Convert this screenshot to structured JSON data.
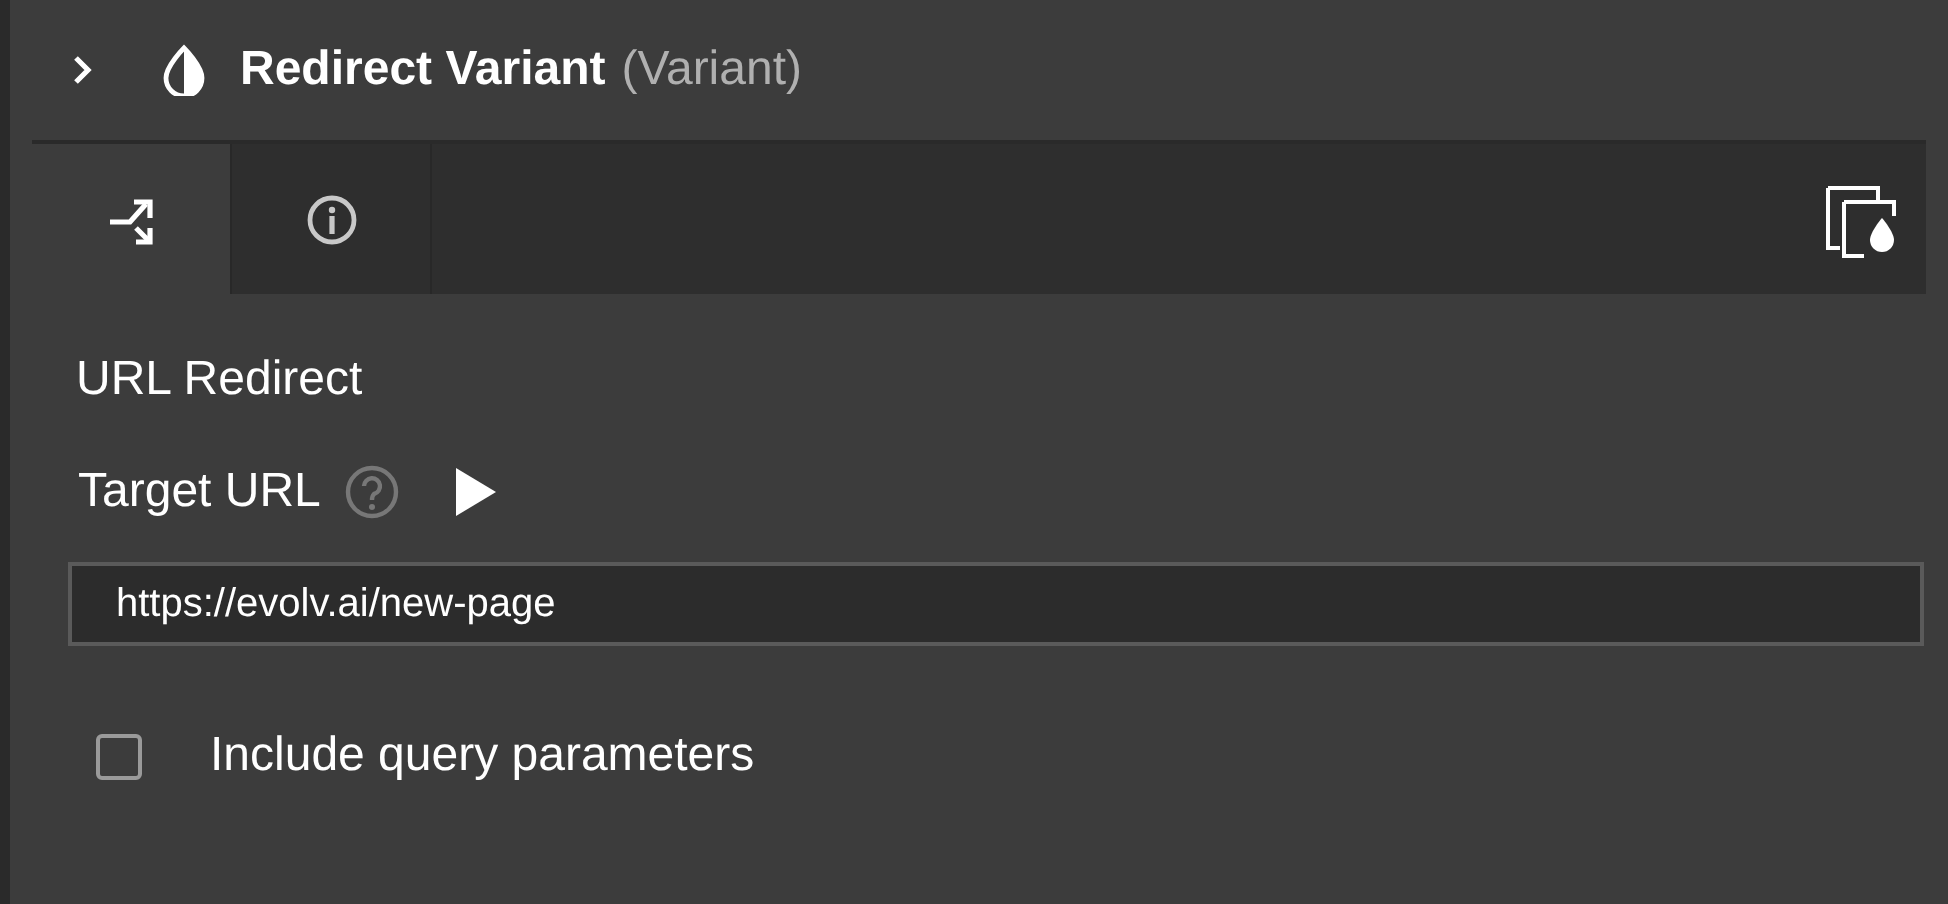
{
  "header": {
    "expanded": false,
    "title": "Redirect Variant",
    "subtitle": "(Variant)"
  },
  "tabs": [
    {
      "kind": "redirect",
      "selected": true
    },
    {
      "kind": "info",
      "selected": false
    }
  ],
  "section_title": "URL Redirect",
  "target_url": {
    "label": "Target URL",
    "value": "https://evolv.ai/new-page"
  },
  "options": [
    {
      "label": "Include query parameters",
      "checked": false
    }
  ]
}
